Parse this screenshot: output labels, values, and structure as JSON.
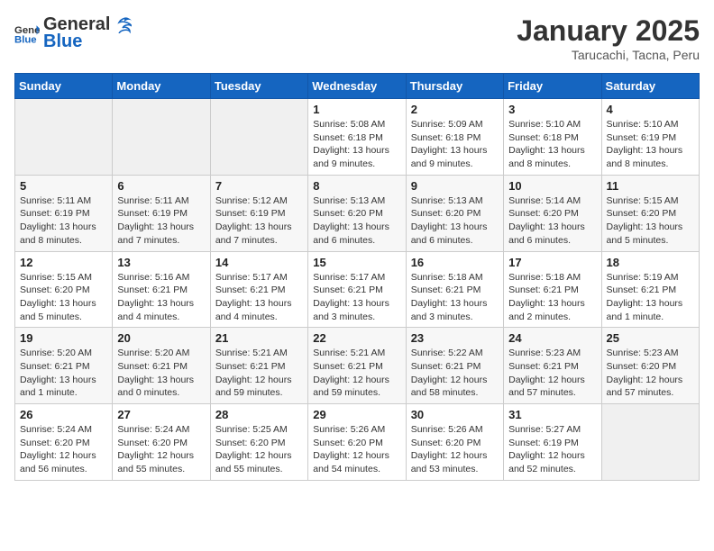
{
  "header": {
    "logo_general": "General",
    "logo_blue": "Blue",
    "title": "January 2025",
    "subtitle": "Tarucachi, Tacna, Peru"
  },
  "weekdays": [
    "Sunday",
    "Monday",
    "Tuesday",
    "Wednesday",
    "Thursday",
    "Friday",
    "Saturday"
  ],
  "weeks": [
    [
      {
        "day": "",
        "detail": ""
      },
      {
        "day": "",
        "detail": ""
      },
      {
        "day": "",
        "detail": ""
      },
      {
        "day": "1",
        "detail": "Sunrise: 5:08 AM\nSunset: 6:18 PM\nDaylight: 13 hours and 9 minutes."
      },
      {
        "day": "2",
        "detail": "Sunrise: 5:09 AM\nSunset: 6:18 PM\nDaylight: 13 hours and 9 minutes."
      },
      {
        "day": "3",
        "detail": "Sunrise: 5:10 AM\nSunset: 6:18 PM\nDaylight: 13 hours and 8 minutes."
      },
      {
        "day": "4",
        "detail": "Sunrise: 5:10 AM\nSunset: 6:19 PM\nDaylight: 13 hours and 8 minutes."
      }
    ],
    [
      {
        "day": "5",
        "detail": "Sunrise: 5:11 AM\nSunset: 6:19 PM\nDaylight: 13 hours and 8 minutes."
      },
      {
        "day": "6",
        "detail": "Sunrise: 5:11 AM\nSunset: 6:19 PM\nDaylight: 13 hours and 7 minutes."
      },
      {
        "day": "7",
        "detail": "Sunrise: 5:12 AM\nSunset: 6:19 PM\nDaylight: 13 hours and 7 minutes."
      },
      {
        "day": "8",
        "detail": "Sunrise: 5:13 AM\nSunset: 6:20 PM\nDaylight: 13 hours and 6 minutes."
      },
      {
        "day": "9",
        "detail": "Sunrise: 5:13 AM\nSunset: 6:20 PM\nDaylight: 13 hours and 6 minutes."
      },
      {
        "day": "10",
        "detail": "Sunrise: 5:14 AM\nSunset: 6:20 PM\nDaylight: 13 hours and 6 minutes."
      },
      {
        "day": "11",
        "detail": "Sunrise: 5:15 AM\nSunset: 6:20 PM\nDaylight: 13 hours and 5 minutes."
      }
    ],
    [
      {
        "day": "12",
        "detail": "Sunrise: 5:15 AM\nSunset: 6:20 PM\nDaylight: 13 hours and 5 minutes."
      },
      {
        "day": "13",
        "detail": "Sunrise: 5:16 AM\nSunset: 6:21 PM\nDaylight: 13 hours and 4 minutes."
      },
      {
        "day": "14",
        "detail": "Sunrise: 5:17 AM\nSunset: 6:21 PM\nDaylight: 13 hours and 4 minutes."
      },
      {
        "day": "15",
        "detail": "Sunrise: 5:17 AM\nSunset: 6:21 PM\nDaylight: 13 hours and 3 minutes."
      },
      {
        "day": "16",
        "detail": "Sunrise: 5:18 AM\nSunset: 6:21 PM\nDaylight: 13 hours and 3 minutes."
      },
      {
        "day": "17",
        "detail": "Sunrise: 5:18 AM\nSunset: 6:21 PM\nDaylight: 13 hours and 2 minutes."
      },
      {
        "day": "18",
        "detail": "Sunrise: 5:19 AM\nSunset: 6:21 PM\nDaylight: 13 hours and 1 minute."
      }
    ],
    [
      {
        "day": "19",
        "detail": "Sunrise: 5:20 AM\nSunset: 6:21 PM\nDaylight: 13 hours and 1 minute."
      },
      {
        "day": "20",
        "detail": "Sunrise: 5:20 AM\nSunset: 6:21 PM\nDaylight: 13 hours and 0 minutes."
      },
      {
        "day": "21",
        "detail": "Sunrise: 5:21 AM\nSunset: 6:21 PM\nDaylight: 12 hours and 59 minutes."
      },
      {
        "day": "22",
        "detail": "Sunrise: 5:21 AM\nSunset: 6:21 PM\nDaylight: 12 hours and 59 minutes."
      },
      {
        "day": "23",
        "detail": "Sunrise: 5:22 AM\nSunset: 6:21 PM\nDaylight: 12 hours and 58 minutes."
      },
      {
        "day": "24",
        "detail": "Sunrise: 5:23 AM\nSunset: 6:21 PM\nDaylight: 12 hours and 57 minutes."
      },
      {
        "day": "25",
        "detail": "Sunrise: 5:23 AM\nSunset: 6:20 PM\nDaylight: 12 hours and 57 minutes."
      }
    ],
    [
      {
        "day": "26",
        "detail": "Sunrise: 5:24 AM\nSunset: 6:20 PM\nDaylight: 12 hours and 56 minutes."
      },
      {
        "day": "27",
        "detail": "Sunrise: 5:24 AM\nSunset: 6:20 PM\nDaylight: 12 hours and 55 minutes."
      },
      {
        "day": "28",
        "detail": "Sunrise: 5:25 AM\nSunset: 6:20 PM\nDaylight: 12 hours and 55 minutes."
      },
      {
        "day": "29",
        "detail": "Sunrise: 5:26 AM\nSunset: 6:20 PM\nDaylight: 12 hours and 54 minutes."
      },
      {
        "day": "30",
        "detail": "Sunrise: 5:26 AM\nSunset: 6:20 PM\nDaylight: 12 hours and 53 minutes."
      },
      {
        "day": "31",
        "detail": "Sunrise: 5:27 AM\nSunset: 6:19 PM\nDaylight: 12 hours and 52 minutes."
      },
      {
        "day": "",
        "detail": ""
      }
    ]
  ]
}
